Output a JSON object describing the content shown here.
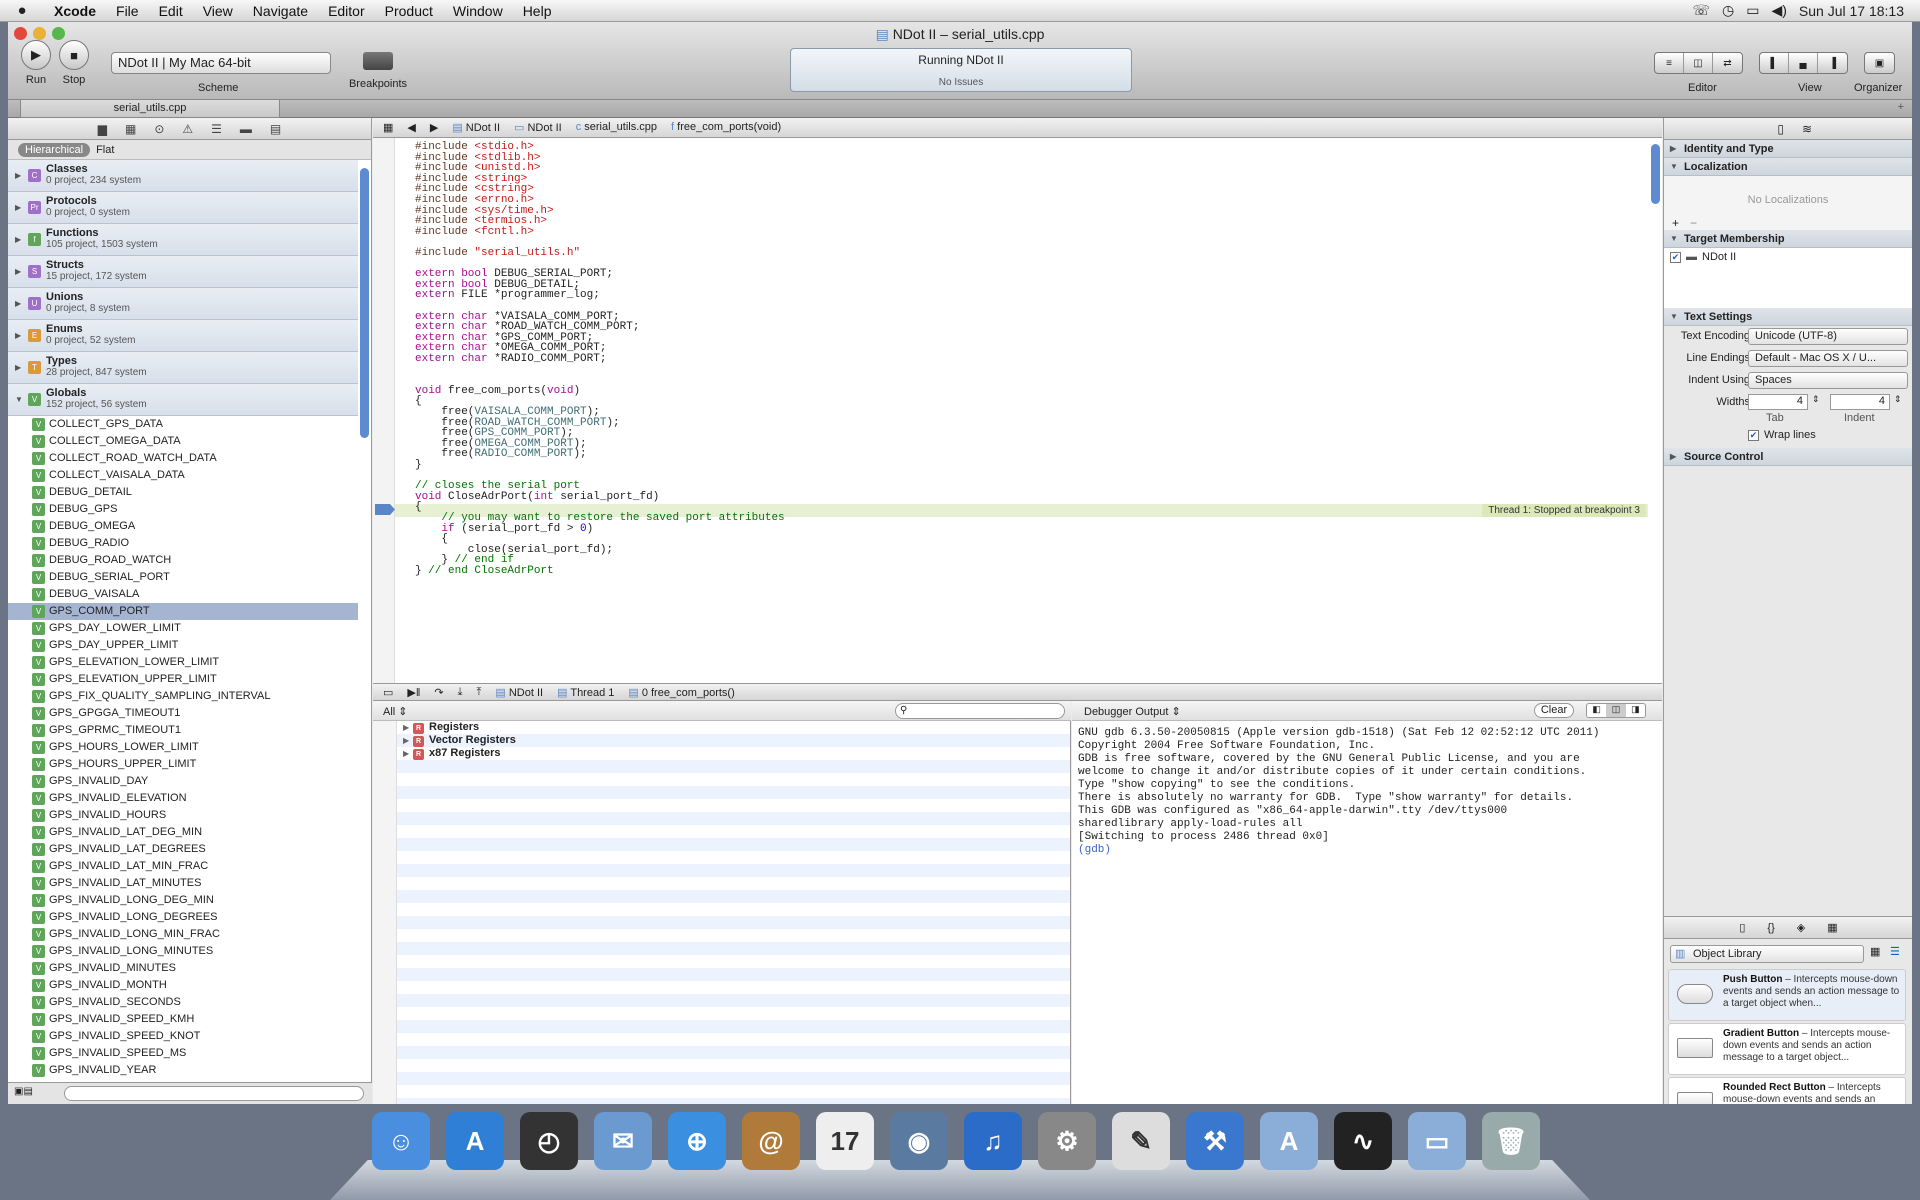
{
  "menubar": {
    "app": "Xcode",
    "items": [
      "File",
      "Edit",
      "View",
      "Navigate",
      "Editor",
      "Product",
      "Window",
      "Help"
    ],
    "clock": "Sun Jul 17  18:13"
  },
  "window": {
    "title": "NDot II – serial_utils.cpp",
    "tab": "serial_utils.cpp"
  },
  "toolbar": {
    "run": "Run",
    "stop": "Stop",
    "scheme_value": "NDot II  |  My Mac 64-bit",
    "scheme_label": "Scheme",
    "breakpoints": "Breakpoints",
    "status": "Running NDot II",
    "issues": "No Issues",
    "editor": "Editor",
    "view": "View",
    "organizer": "Organizer"
  },
  "navigator": {
    "scope_on": "Hierarchical",
    "scope_off": "Flat",
    "groups": [
      {
        "name": "Classes",
        "sub": "0 project, 234 system",
        "letter": "C",
        "color": "#a070c8"
      },
      {
        "name": "Protocols",
        "sub": "0 project, 0 system",
        "letter": "Pr",
        "color": "#a070c8"
      },
      {
        "name": "Functions",
        "sub": "105 project, 1503 system",
        "letter": "f",
        "color": "#5fa55a"
      },
      {
        "name": "Structs",
        "sub": "15 project, 172 system",
        "letter": "S",
        "color": "#a070c8"
      },
      {
        "name": "Unions",
        "sub": "0 project, 8 system",
        "letter": "U",
        "color": "#a070c8"
      },
      {
        "name": "Enums",
        "sub": "0 project, 52 system",
        "letter": "E",
        "color": "#d89a3a"
      },
      {
        "name": "Types",
        "sub": "28 project, 847 system",
        "letter": "T",
        "color": "#d89a3a"
      },
      {
        "name": "Globals",
        "sub": "152 project, 56 system",
        "letter": "V",
        "color": "#5fa55a"
      }
    ],
    "globals": [
      "COLLECT_GPS_DATA",
      "COLLECT_OMEGA_DATA",
      "COLLECT_ROAD_WATCH_DATA",
      "COLLECT_VAISALA_DATA",
      "DEBUG_DETAIL",
      "DEBUG_GPS",
      "DEBUG_OMEGA",
      "DEBUG_RADIO",
      "DEBUG_ROAD_WATCH",
      "DEBUG_SERIAL_PORT",
      "DEBUG_VAISALA",
      "GPS_COMM_PORT",
      "GPS_DAY_LOWER_LIMIT",
      "GPS_DAY_UPPER_LIMIT",
      "GPS_ELEVATION_LOWER_LIMIT",
      "GPS_ELEVATION_UPPER_LIMIT",
      "GPS_FIX_QUALITY_SAMPLING_INTERVAL",
      "GPS_GPGGA_TIMEOUT1",
      "GPS_GPRMC_TIMEOUT1",
      "GPS_HOURS_LOWER_LIMIT",
      "GPS_HOURS_UPPER_LIMIT",
      "GPS_INVALID_DAY",
      "GPS_INVALID_ELEVATION",
      "GPS_INVALID_HOURS",
      "GPS_INVALID_LAT_DEG_MIN",
      "GPS_INVALID_LAT_DEGREES",
      "GPS_INVALID_LAT_MIN_FRAC",
      "GPS_INVALID_LAT_MINUTES",
      "GPS_INVALID_LONG_DEG_MIN",
      "GPS_INVALID_LONG_DEGREES",
      "GPS_INVALID_LONG_MIN_FRAC",
      "GPS_INVALID_LONG_MINUTES",
      "GPS_INVALID_MINUTES",
      "GPS_INVALID_MONTH",
      "GPS_INVALID_SECONDS",
      "GPS_INVALID_SPEED_KMH",
      "GPS_INVALID_SPEED_KNOT",
      "GPS_INVALID_SPEED_MS",
      "GPS_INVALID_YEAR"
    ],
    "selected": "GPS_COMM_PORT"
  },
  "jumpbar": [
    "NDot II",
    "NDot II",
    "serial_utils.cpp",
    "free_com_ports(void)"
  ],
  "code": [
    [
      [
        "inc",
        "#include "
      ],
      [
        "str",
        "<stdio.h>"
      ]
    ],
    [
      [
        "inc",
        "#include "
      ],
      [
        "str",
        "<stdlib.h>"
      ]
    ],
    [
      [
        "inc",
        "#include "
      ],
      [
        "str",
        "<unistd.h>"
      ]
    ],
    [
      [
        "inc",
        "#include "
      ],
      [
        "str",
        "<string>"
      ]
    ],
    [
      [
        "inc",
        "#include "
      ],
      [
        "str",
        "<cstring>"
      ]
    ],
    [
      [
        "inc",
        "#include "
      ],
      [
        "str",
        "<errno.h>"
      ]
    ],
    [
      [
        "inc",
        "#include "
      ],
      [
        "str",
        "<sys/time.h>"
      ]
    ],
    [
      [
        "inc",
        "#include "
      ],
      [
        "str",
        "<termios.h>"
      ]
    ],
    [
      [
        "inc",
        "#include "
      ],
      [
        "str",
        "<fcntl.h>"
      ]
    ],
    [],
    [
      [
        "inc",
        "#include "
      ],
      [
        "str",
        "\"serial_utils.h\""
      ]
    ],
    [],
    [
      [
        "kw",
        "extern bool "
      ],
      [
        "",
        "DEBUG_SERIAL_PORT;"
      ]
    ],
    [
      [
        "kw",
        "extern bool "
      ],
      [
        "",
        "DEBUG_DETAIL;"
      ]
    ],
    [
      [
        "kw",
        "extern "
      ],
      [
        "",
        "FILE *programmer_log;"
      ]
    ],
    [],
    [
      [
        "kw",
        "extern char "
      ],
      [
        "",
        "*VAISALA_COMM_PORT;"
      ]
    ],
    [
      [
        "kw",
        "extern char "
      ],
      [
        "",
        "*ROAD_WATCH_COMM_PORT;"
      ]
    ],
    [
      [
        "kw",
        "extern char "
      ],
      [
        "",
        "*GPS_COMM_PORT;"
      ]
    ],
    [
      [
        "kw",
        "extern char "
      ],
      [
        "",
        "*OMEGA_COMM_PORT;"
      ]
    ],
    [
      [
        "kw",
        "extern char "
      ],
      [
        "",
        "*RADIO_COMM_PORT;"
      ]
    ],
    [],
    [],
    [
      [
        "kw",
        "void "
      ],
      [
        "",
        "free_com_ports("
      ],
      [
        "kw",
        "void"
      ],
      [
        "",
        ")"
      ]
    ],
    [
      [
        "",
        "{"
      ]
    ],
    [
      [
        "",
        "    free("
      ],
      [
        "var",
        "VAISALA_COMM_PORT"
      ],
      [
        "",
        ");"
      ]
    ],
    [
      [
        "",
        "    free("
      ],
      [
        "var",
        "ROAD_WATCH_COMM_PORT"
      ],
      [
        "",
        ");"
      ]
    ],
    [
      [
        "",
        "    free("
      ],
      [
        "var",
        "GPS_COMM_PORT"
      ],
      [
        "",
        ");"
      ]
    ],
    [
      [
        "",
        "    free("
      ],
      [
        "var",
        "OMEGA_COMM_PORT"
      ],
      [
        "",
        ");"
      ]
    ],
    [
      [
        "",
        "    free("
      ],
      [
        "var",
        "RADIO_COMM_PORT"
      ],
      [
        "",
        ");"
      ]
    ],
    [
      [
        "",
        "}"
      ]
    ],
    [],
    [
      [
        "cm",
        "// closes the serial port"
      ]
    ],
    [
      [
        "kw",
        "void "
      ],
      [
        "",
        "CloseAdrPort("
      ],
      [
        "kw",
        "int "
      ],
      [
        "",
        "serial_port_fd)"
      ]
    ],
    [
      [
        "",
        "{"
      ]
    ],
    [
      [
        "cm",
        "    // you may want to restore the saved port attributes"
      ]
    ],
    [
      [
        "kw",
        "    if "
      ],
      [
        "",
        "(serial_port_fd > "
      ],
      [
        "num",
        "0"
      ],
      [
        "",
        ")"
      ]
    ],
    [
      [
        "",
        "    {"
      ]
    ],
    [
      [
        "",
        "        close(serial_port_fd);"
      ]
    ],
    [
      [
        "",
        "    } "
      ],
      [
        "cm",
        "// end if"
      ]
    ],
    [
      [
        "",
        "} "
      ],
      [
        "cm",
        "// end CloseAdrPort"
      ]
    ]
  ],
  "thread_tag": "Thread 1: Stopped at breakpoint 3",
  "debugbar": [
    "NDot II",
    "Thread 1",
    "0 free_com_ports()"
  ],
  "vars": {
    "scope": "All",
    "registers": [
      "Registers",
      "Vector Registers",
      "x87 Registers"
    ]
  },
  "output": {
    "title": "Debugger Output",
    "clear": "Clear",
    "lines": [
      "GNU gdb 6.3.50-20050815 (Apple version gdb-1518) (Sat Feb 12 02:52:12 UTC 2011)",
      "Copyright 2004 Free Software Foundation, Inc.",
      "GDB is free software, covered by the GNU General Public License, and you are",
      "welcome to change it and/or distribute copies of it under certain conditions.",
      "Type \"show copying\" to see the conditions.",
      "There is absolutely no warranty for GDB.  Type \"show warranty\" for details.",
      "This GDB was configured as \"x86_64-apple-darwin\".tty /dev/ttys000",
      "sharedlibrary apply-load-rules all",
      "[Switching to process 2486 thread 0x0]"
    ],
    "prompt": "(gdb)"
  },
  "inspector": {
    "identity": "Identity and Type",
    "localization": "Localization",
    "no_loc": "No Localizations",
    "target": "Target Membership",
    "target_item": "NDot II",
    "text_settings": "Text Settings",
    "enc_label": "Text Encoding",
    "enc": "Unicode (UTF-8)",
    "le_label": "Line Endings",
    "le": "Default - Mac OS X / U...",
    "indent_label": "Indent Using",
    "indent": "Spaces",
    "widths_label": "Widths",
    "tab_w": "4",
    "indent_w": "4",
    "tab": "Tab",
    "indent_l": "Indent",
    "wrap": "Wrap lines",
    "source_control": "Source Control"
  },
  "library": {
    "selector": "Object Library",
    "items": [
      {
        "name": "Push Button",
        "desc": " – Intercepts mouse-down events and sends an action message to a target object when..."
      },
      {
        "name": "Gradient Button",
        "desc": " – Intercepts mouse-down events and sends an action message to a target object..."
      },
      {
        "name": "Rounded Rect Button",
        "desc": " – Intercepts mouse-down events and sends an"
      }
    ]
  },
  "dock": [
    {
      "n": "finder-icon",
      "c": "#4a8ee0",
      "g": "☺"
    },
    {
      "n": "app-store-icon",
      "c": "#2f7fd6",
      "g": "A"
    },
    {
      "n": "dashboard-icon",
      "c": "#333",
      "g": "◴"
    },
    {
      "n": "mail-icon",
      "c": "#6a9ad0",
      "g": "✉"
    },
    {
      "n": "safari-icon",
      "c": "#3a8fe0",
      "g": "⊕"
    },
    {
      "n": "address-book-icon",
      "c": "#b07a3a",
      "g": "@"
    },
    {
      "n": "ical-icon",
      "c": "#eee",
      "g": "17"
    },
    {
      "n": "photo-booth-icon",
      "c": "#5a7aa0",
      "g": "◉"
    },
    {
      "n": "itunes-icon",
      "c": "#2a6cc8",
      "g": "♫"
    },
    {
      "n": "system-preferences-icon",
      "c": "#888",
      "g": "⚙"
    },
    {
      "n": "textedit-icon",
      "c": "#ddd",
      "g": "✎"
    },
    {
      "n": "xcode-icon",
      "c": "#3a78d0",
      "g": "⚒"
    },
    {
      "n": "applications-folder-icon",
      "c": "#8aaed8",
      "g": "A"
    },
    {
      "n": "activity-monitor-icon",
      "c": "#222",
      "g": "∿"
    },
    {
      "n": "documents-folder-icon",
      "c": "#8aaed8",
      "g": "▭"
    },
    {
      "n": "trash-icon",
      "c": "#9aa",
      "g": "🗑"
    }
  ]
}
